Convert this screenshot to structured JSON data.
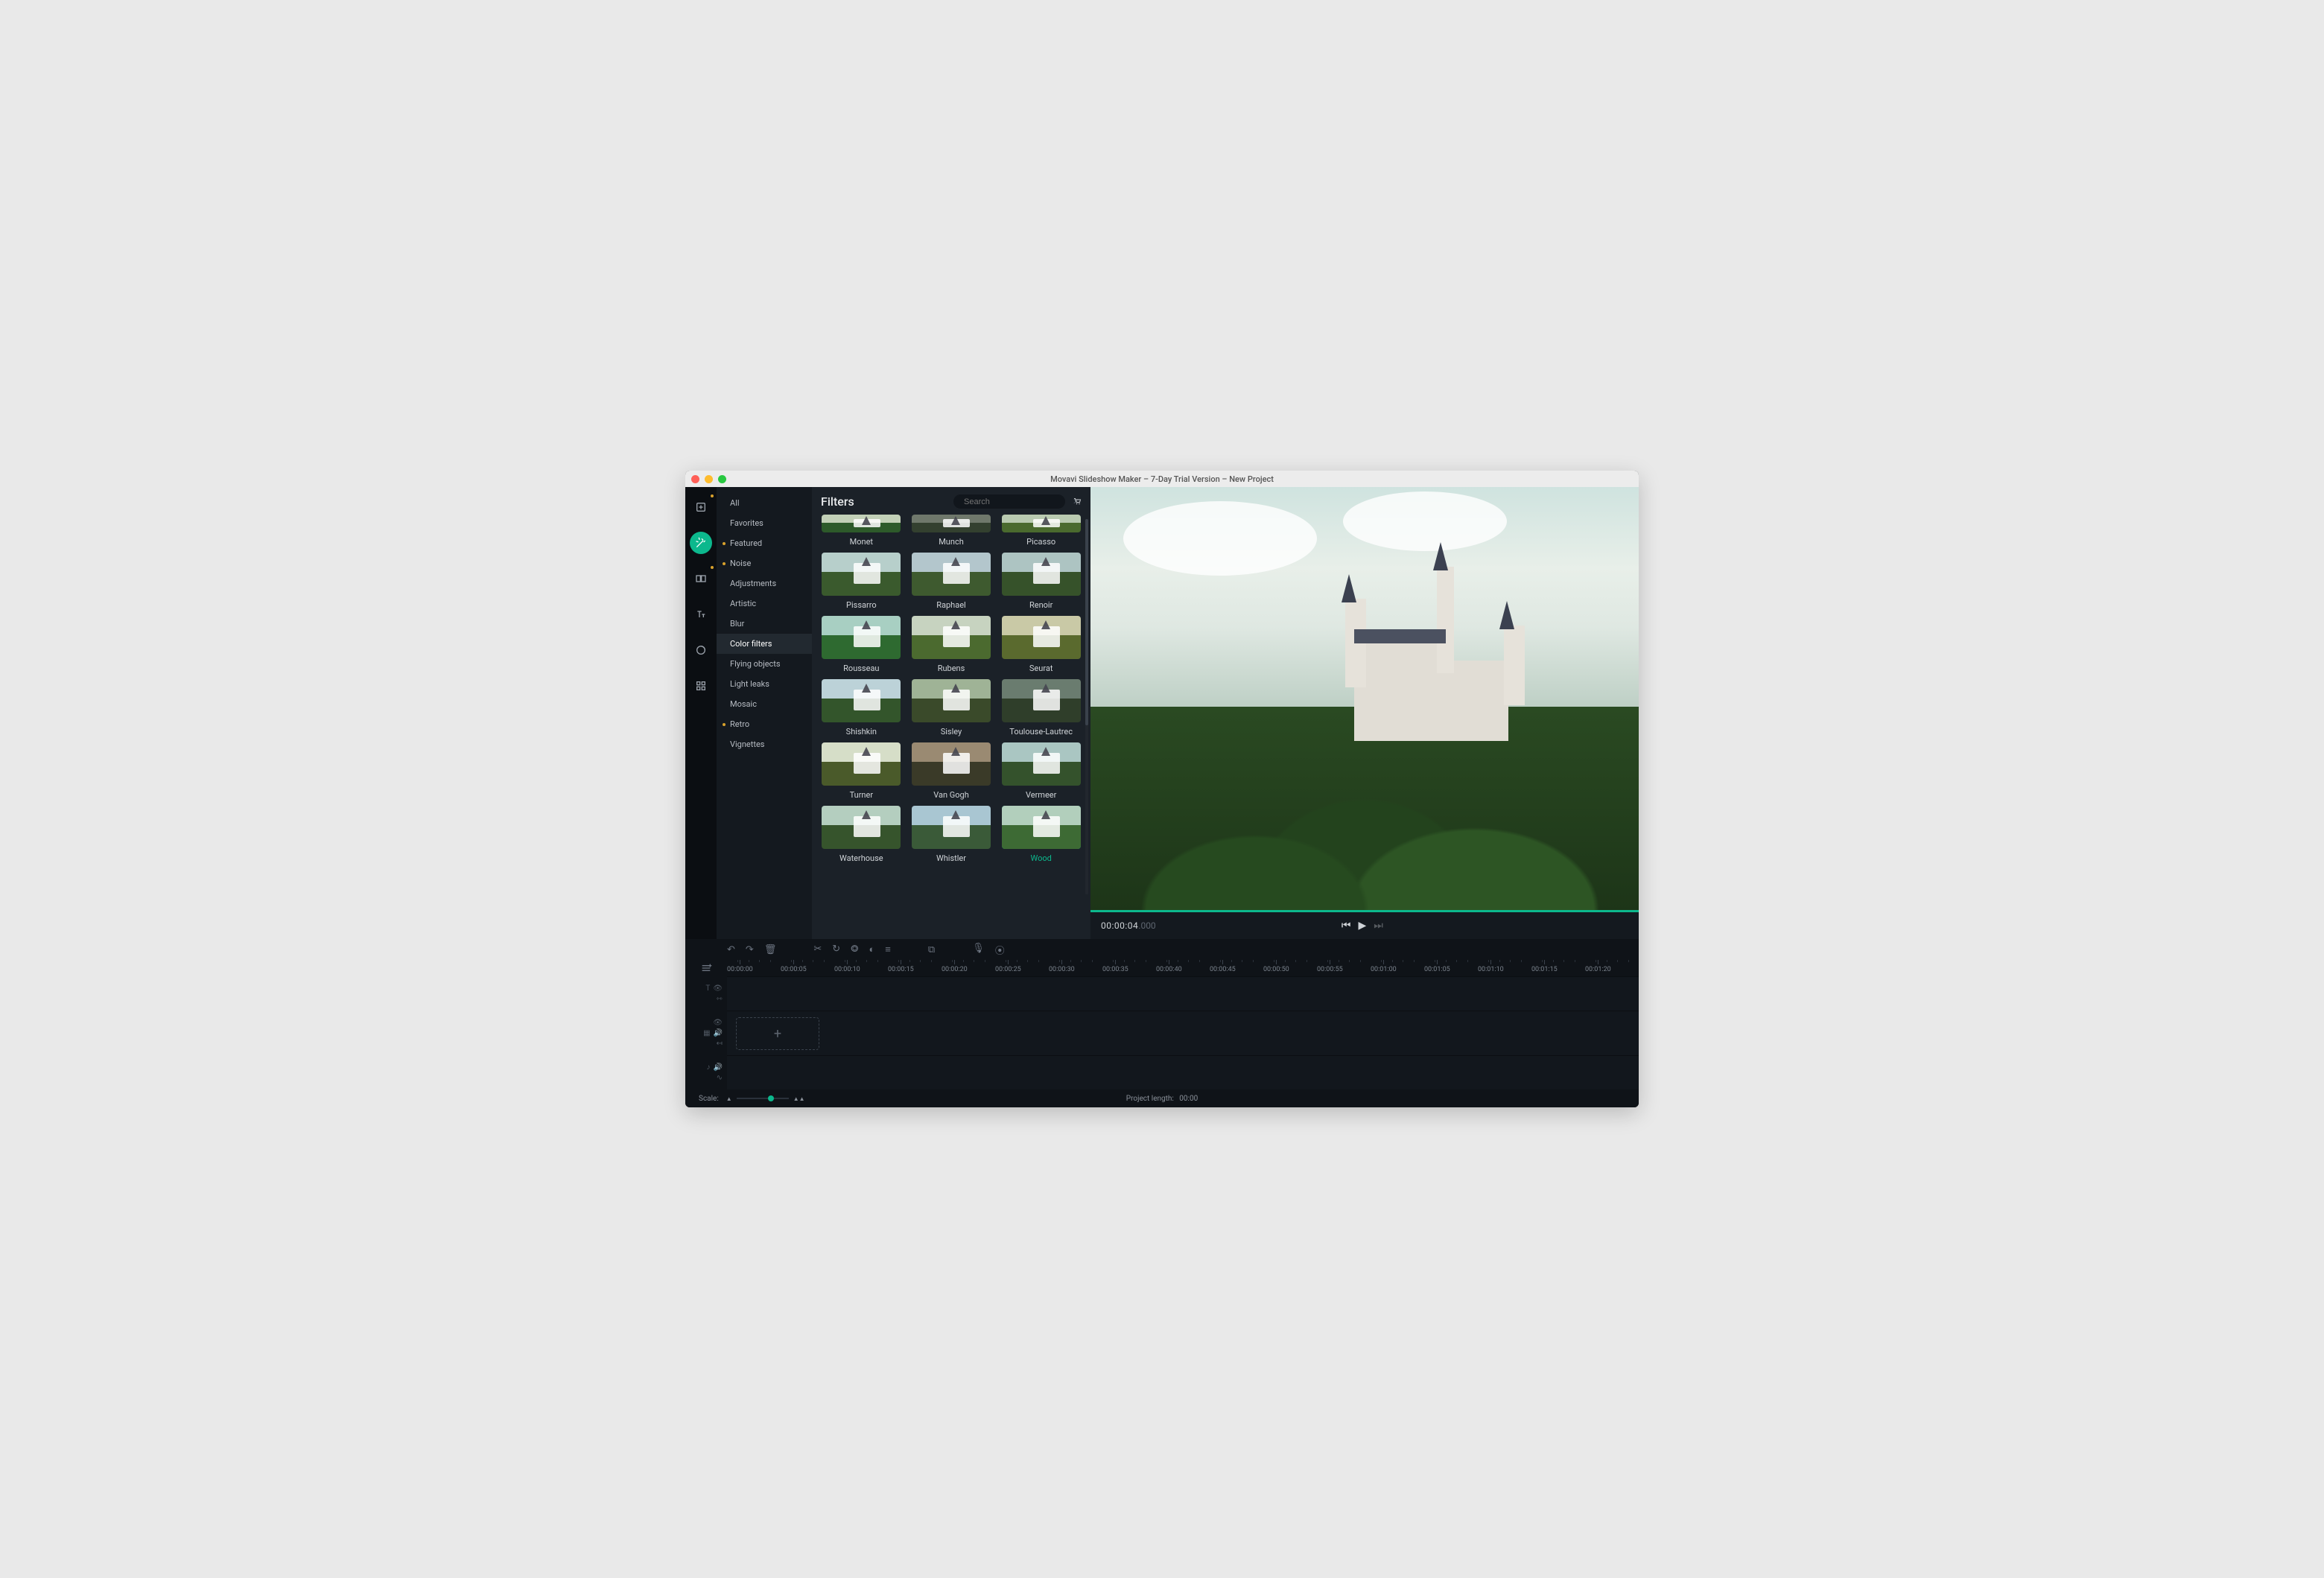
{
  "titlebar": {
    "title": "Movavi Slideshow Maker – 7-Day Trial Version – New Project"
  },
  "toolrail": [
    {
      "name": "import",
      "dot": true
    },
    {
      "name": "filters",
      "dot": false,
      "active": true
    },
    {
      "name": "transitions",
      "dot": true
    },
    {
      "name": "titles",
      "dot": false
    },
    {
      "name": "stickers",
      "dot": false
    },
    {
      "name": "more",
      "dot": false
    }
  ],
  "categories": [
    {
      "label": "All"
    },
    {
      "label": "Favorites"
    },
    {
      "label": "Featured",
      "marked": true
    },
    {
      "label": "Noise",
      "marked": true
    },
    {
      "label": "Adjustments"
    },
    {
      "label": "Artistic"
    },
    {
      "label": "Blur"
    },
    {
      "label": "Color filters",
      "active": true
    },
    {
      "label": "Flying objects"
    },
    {
      "label": "Light leaks"
    },
    {
      "label": "Mosaic"
    },
    {
      "label": "Retro",
      "marked": true
    },
    {
      "label": "Vignettes"
    }
  ],
  "filtersPanel": {
    "title": "Filters",
    "searchPlaceholder": "Search",
    "items": [
      {
        "label": "Monet",
        "half": true,
        "sky": "#c2d0b7",
        "ground": "#2d5a2a"
      },
      {
        "label": "Munch",
        "half": true,
        "sky": "#6f786b",
        "ground": "#33402f"
      },
      {
        "label": "Picasso",
        "half": true,
        "sky": "#b9cab0",
        "ground": "#4a6a2e"
      },
      {
        "label": "Pissarro",
        "sky": "#b7cfcb",
        "ground": "#3a5a2d"
      },
      {
        "label": "Raphael",
        "sky": "#b3c6cc",
        "ground": "#3e5a2f"
      },
      {
        "label": "Renoir",
        "sky": "#adc4c2",
        "ground": "#36522a"
      },
      {
        "label": "Rousseau",
        "sky": "#a8cfc2",
        "ground": "#2e6a30"
      },
      {
        "label": "Rubens",
        "sky": "#c7d3c0",
        "ground": "#4b6a2f"
      },
      {
        "label": "Seurat",
        "sky": "#c9c9a6",
        "ground": "#5a6a2e"
      },
      {
        "label": "Shishkin",
        "sky": "#bcd2d8",
        "ground": "#33552b"
      },
      {
        "label": "Sisley",
        "sky": "#9fb396",
        "ground": "#3a4a2a"
      },
      {
        "label": "Toulouse-Lautrec",
        "sky": "#6a7c6f",
        "ground": "#2f3e2a"
      },
      {
        "label": "Turner",
        "sky": "#d6dec8",
        "ground": "#4a5a2a"
      },
      {
        "label": "Van Gogh",
        "sky": "#9a8a72",
        "ground": "#3a3a28"
      },
      {
        "label": "Vermeer",
        "sky": "#aac6c2",
        "ground": "#34522c"
      },
      {
        "label": "Waterhouse",
        "sky": "#b4cebf",
        "ground": "#36542c"
      },
      {
        "label": "Whistler",
        "sky": "#a9c6d2",
        "ground": "#3a5a38"
      },
      {
        "label": "Wood",
        "selected": true,
        "sky": "#b2cfbc",
        "ground": "#3d6a34"
      }
    ]
  },
  "preview": {
    "timecode": "00:00:04",
    "timecode_ms": ".000"
  },
  "timelineTools": {
    "undo": "↶",
    "redo": "↷",
    "delete": "🗑",
    "cut": "✂",
    "rotate": "↻",
    "crop": "⭗",
    "color": "◐",
    "props": "≡",
    "trans": "⧉",
    "mic": "🎙",
    "cam": "⦿"
  },
  "ruler": {
    "majors": [
      "00:00:00",
      "00:00:05",
      "00:00:10",
      "00:00:15",
      "00:00:20",
      "00:00:25",
      "00:00:30",
      "00:00:35",
      "00:00:40",
      "00:00:45",
      "00:00:50",
      "00:00:55",
      "00:01:00",
      "00:01:05",
      "00:01:10",
      "00:01:15",
      "00:01:20"
    ]
  },
  "drop": {
    "label": "+"
  },
  "statusbar": {
    "scaleLabel": "Scale:",
    "projectLengthLabel": "Project length:",
    "projectLengthValue": "00:00"
  }
}
